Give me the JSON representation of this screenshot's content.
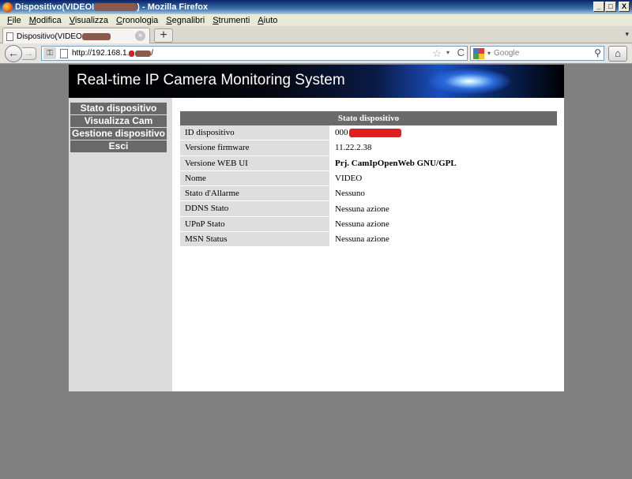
{
  "window": {
    "title_prefix": "Dispositivo(VIDEOI",
    "title_suffix": ") - Mozilla Firefox",
    "min_label": "_",
    "max_label": "□",
    "close_label": "X"
  },
  "menu": [
    {
      "u": "F",
      "rest": "ile"
    },
    {
      "u": "M",
      "rest": "odifica"
    },
    {
      "u": "V",
      "rest": "isualizza"
    },
    {
      "u": "C",
      "rest": "ronologia"
    },
    {
      "u": "S",
      "rest": "egnalibri"
    },
    {
      "u": "S",
      "rest": "trumenti"
    },
    {
      "u": "A",
      "rest": "iuto"
    }
  ],
  "tab": {
    "label": "Dispositivo(VIDEO",
    "close": "×",
    "new_tab": "+",
    "list": "▾"
  },
  "nav": {
    "back": "←",
    "forward": "→",
    "url_prefix": "http://192.168.1.",
    "url_suffix": "/",
    "star": "☆",
    "dropdown": "▾",
    "reload": "C",
    "search_placeholder": "Google",
    "search_icon": "magnifier-icon",
    "home": "⌂"
  },
  "page": {
    "banner_title": "Real-time IP Camera Monitoring System",
    "sidebar": [
      "Stato dispositivo",
      "Visualizza Cam",
      "Gestione dispositivo",
      "Esci"
    ],
    "table_title": "Stato dispositivo",
    "rows": [
      {
        "label": "ID dispositivo",
        "value": "000"
      },
      {
        "label": "Versione firmware",
        "value": "11.22.2.38"
      },
      {
        "label": "Versione WEB UI",
        "value": "Prj. CamIpOpenWeb GNU/GPL"
      },
      {
        "label": "Nome",
        "value": "VIDEO"
      },
      {
        "label": "Stato d'Allarme",
        "value": "Nessuno"
      },
      {
        "label": "DDNS Stato",
        "value": "Nessuna azione"
      },
      {
        "label": "UPnP Stato",
        "value": "Nessuna azione"
      },
      {
        "label": "MSN Status",
        "value": "Nessuna azione"
      }
    ]
  },
  "colors": {
    "sidebar_button": "#696969",
    "table_header": "#6a6a6a",
    "label_cell": "#dedede",
    "redaction_red": "#e02020"
  }
}
